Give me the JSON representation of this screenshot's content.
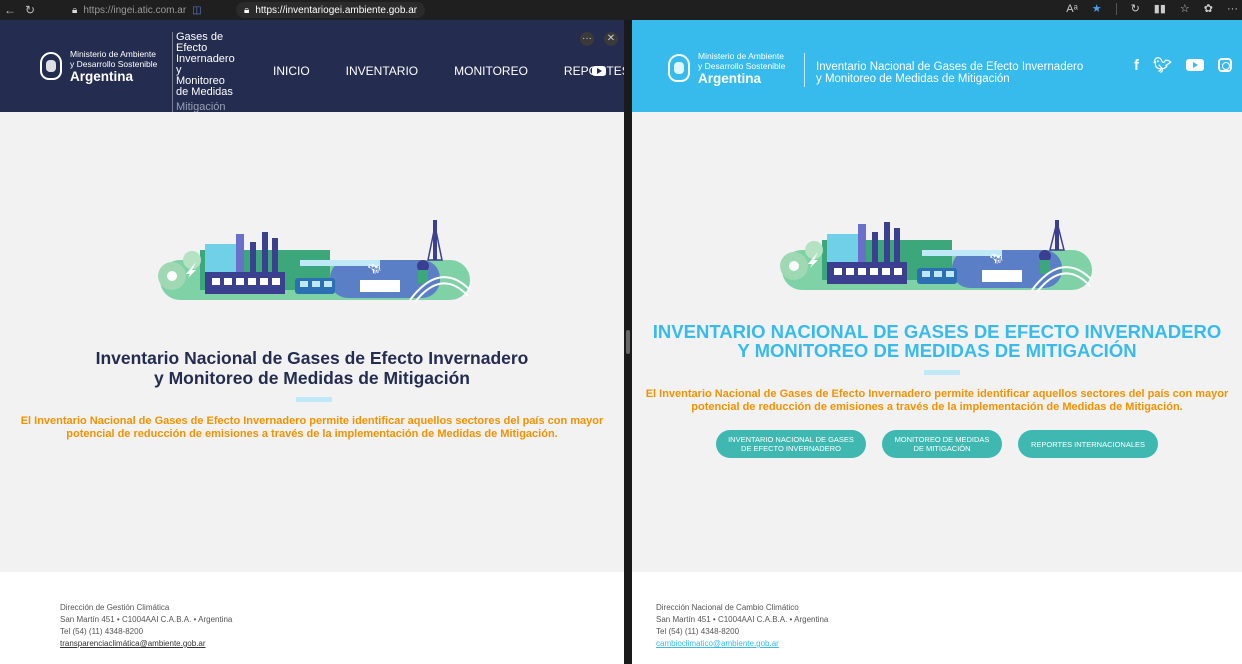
{
  "browser": {
    "left_url": "https://ingei.atic.com.ar",
    "right_url": "https://inventariogei.ambiente.gob.ar"
  },
  "left": {
    "logo": {
      "line1": "Ministerio de Ambiente",
      "line2": "y Desarrollo Sostenible",
      "line3": "Argentina"
    },
    "site_title": [
      "Gases de",
      "Efecto",
      "Invernadero",
      "y",
      "Monitoreo",
      "de Medidas",
      "Mitigación"
    ],
    "menu": [
      "INICIO",
      "INVENTARIO",
      "MONITOREO",
      "REPORTES"
    ],
    "hero_title_1": "Inventario Nacional de Gases de Efecto Invernadero",
    "hero_title_2": "y Monitoreo de Medidas de Mitigación",
    "description_1": "El Inventario Nacional de Gases de Efecto Invernadero permite identificar aquellos sectores del país con mayor",
    "description_2": "potencial de reducción de emisiones a través de la implementación de Medidas de Mitigación.",
    "footer": {
      "line1": "Dirección de Gestión Climática",
      "line2": "San Martín 451 • C1004AAI C.A.B.A. • Argentina",
      "line3": "Tel (54) (11) 4348-8200",
      "email": "transparenciaclimática@ambiente.gob.ar"
    }
  },
  "right": {
    "logo": {
      "line1": "Ministerio de Ambiente",
      "line2": "y Desarrollo Sostenible",
      "line3": "Argentina"
    },
    "site_title_1": "Inventario Nacional de Gases de Efecto Invernadero",
    "site_title_2": "y Monitoreo de Medidas de Mitigación",
    "social": [
      "facebook",
      "twitter",
      "youtube",
      "instagram"
    ],
    "hero_title_1": "INVENTARIO NACIONAL DE GASES DE EFECTO INVERNADERO",
    "hero_title_2": "Y MONITOREO DE MEDIDAS DE MITIGACIÓN",
    "description_1": "El Inventario Nacional de Gases de Efecto Invernadero permite identificar aquellos sectores del país con mayor",
    "description_2": "potencial de reducción de emisiones a través de la implementación de Medidas de Mitigación.",
    "buttons": [
      {
        "l1": "INVENTARIO NACIONAL DE GASES",
        "l2": "DE EFECTO INVERNADERO"
      },
      {
        "l1": "MONITOREO DE MEDIDAS",
        "l2": "DE MITIGACIÓN"
      },
      {
        "l1": "REPORTES INTERNACIONALES",
        "l2": ""
      }
    ],
    "footer": {
      "line1": "Dirección Nacional de Cambio Climático",
      "line2": "San Martín 451 • C1004AAI C.A.B.A. • Argentina",
      "line3": "Tel (54) (11) 4348-8200",
      "email": "cambioclimatico@ambiente.gob.ar"
    }
  },
  "colors": {
    "left_header": "#242c4f",
    "right_header": "#37bbed",
    "accent_orange": "#f39200",
    "button_teal": "#3fb8b2"
  }
}
